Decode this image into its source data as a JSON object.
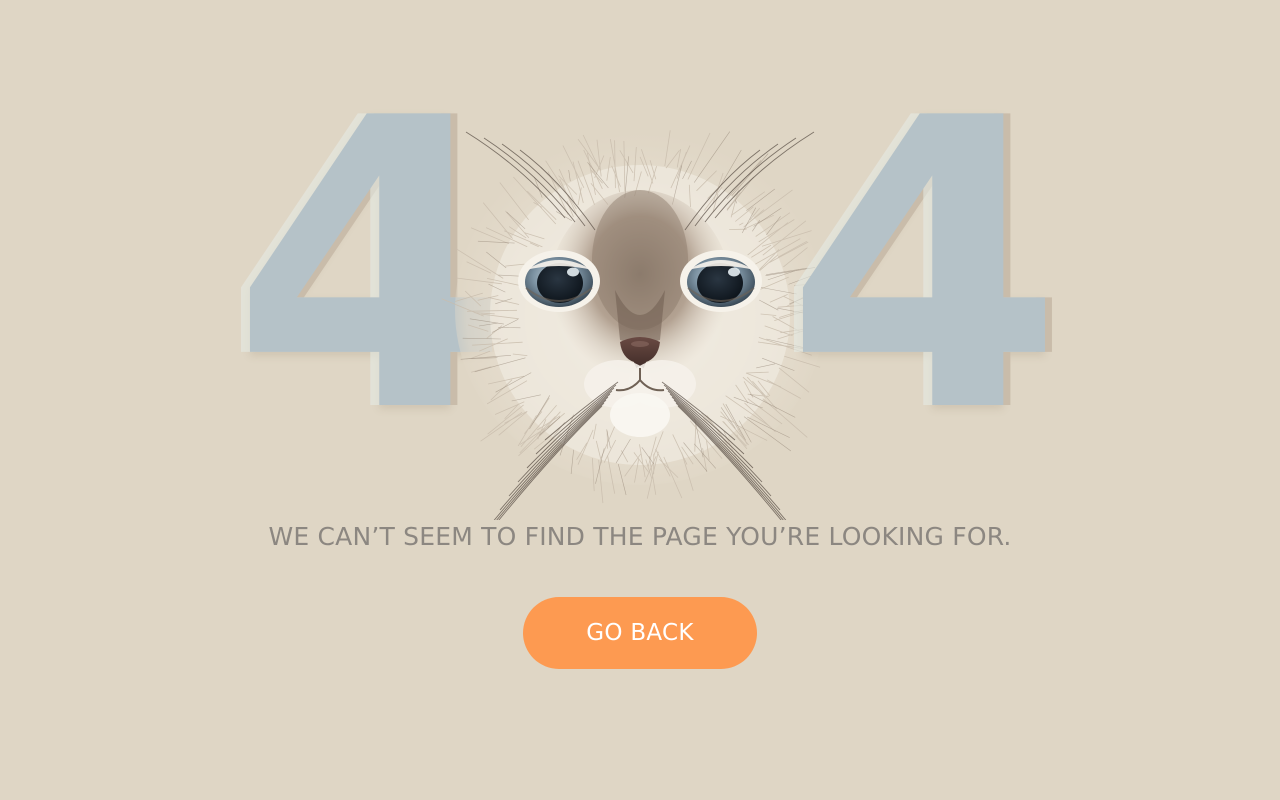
{
  "error_code": {
    "first_digit": "4",
    "last_digit": "4"
  },
  "illustration": {
    "icon": "cat-face-icon"
  },
  "message": "WE CAN’T SEEM TO FIND THE PAGE YOU’RE LOOKING FOR.",
  "button": {
    "label": "GO BACK"
  },
  "colors": {
    "background": "#dfd6c5",
    "digits": "#b5c2c8",
    "message_text": "#8c8781",
    "button_background": "#fd9a51",
    "button_text": "#ffffff"
  }
}
